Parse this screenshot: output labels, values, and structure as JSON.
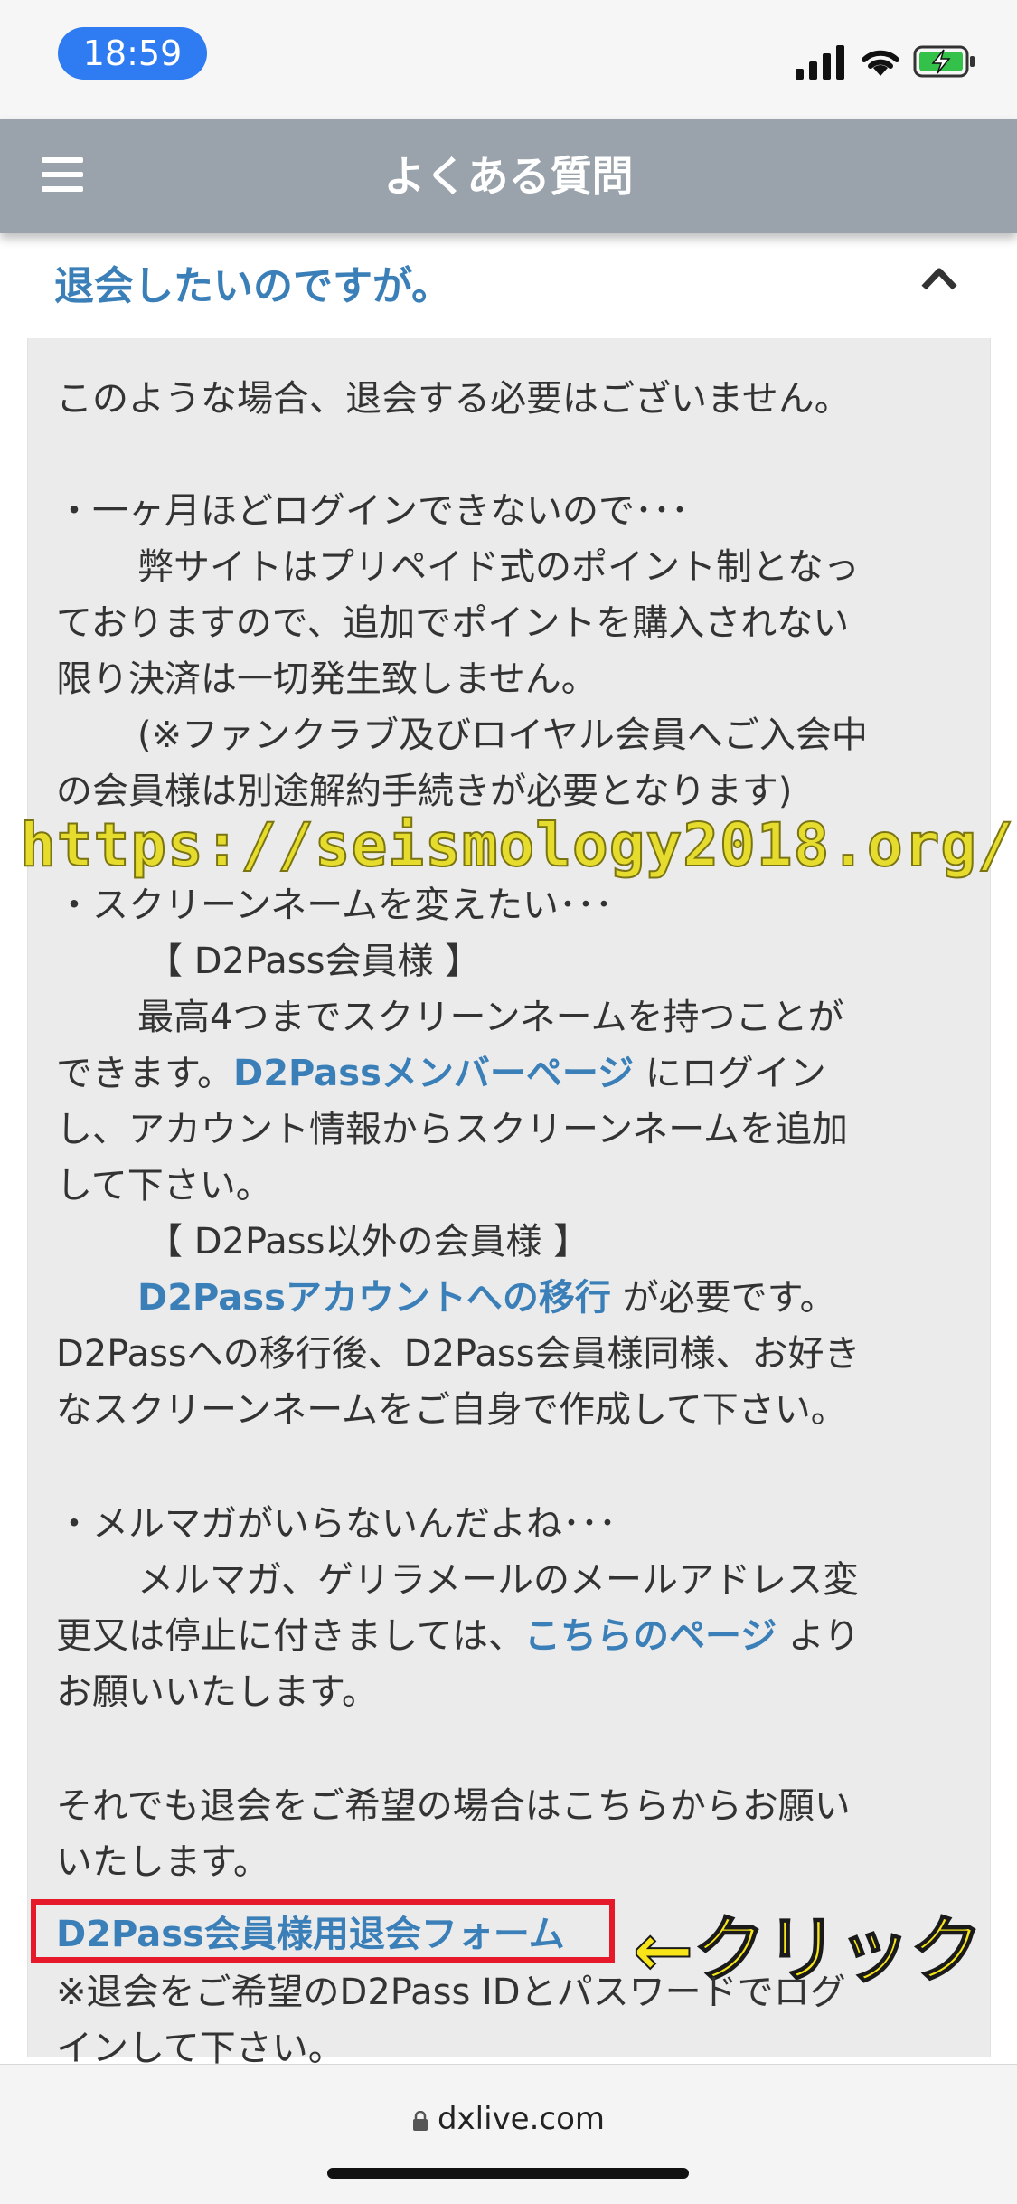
{
  "status_bar": {
    "time": "18:59"
  },
  "header": {
    "title": "よくある質問"
  },
  "faq": {
    "question": "退会したいのですが。",
    "answer": {
      "intro": "このような場合、退会する必要はございません。",
      "login_heading": "・一ヶ月ほどログインできないので･･･",
      "login_l1": "弊サイトはプリペイド式のポイント制となっ",
      "login_l2": "ておりますので、追加でポイントを購入されない",
      "login_l3": "限り決済は一切発生致しません。",
      "login_l4": "(※ファンクラブ及びロイヤル会員へご入会中",
      "login_l5": "の会員様は別途解約手続きが必要となります)",
      "screen_heading": "・スクリーンネームを変えたい･･･",
      "d2pass_member_heading": "【 D2Pass会員様 】",
      "d2pass_l1": "最高4つまでスクリーンネームを持つことが",
      "d2pass_l2_pre": "できます。",
      "d2pass_member_page_link": "D2Passメンバーページ",
      "d2pass_l2_post": " にログイン",
      "d2pass_l3": "し、アカウント情報からスクリーンネームを追加",
      "d2pass_l4": "して下さい。",
      "non_d2pass_heading": "【 D2Pass以外の会員様 】",
      "migration_link": "D2Passアカウントへの移行",
      "migration_post": " が必要です。",
      "non_d2pass_l2": "D2Passへの移行後、D2Pass会員様同様、お好き",
      "non_d2pass_l3": "なスクリーンネームをご自身で作成して下さい。",
      "mailmag_heading": "・メルマガがいらないんだよね･･･",
      "mailmag_l1": "メルマガ、ゲリラメールのメールアドレス変",
      "mailmag_l2_pre": "更又は停止に付きましては、",
      "this_page_link": "こちらのページ",
      "mailmag_l2_post": " より",
      "mailmag_l3": "お願いいたします。",
      "still_l1": "それでも退会をご希望の場合はこちらからお願い",
      "still_l2": "いたします。",
      "withdraw_form_link": "D2Pass会員様用退会フォーム",
      "note_l1": "※退会をご希望のD2Pass IDとパスワードでログ",
      "note_l2": "インして下さい。"
    }
  },
  "overlay": {
    "watermark": "https://seismology2018.org/",
    "click_annotation": "←クリック"
  },
  "bottom_bar": {
    "url": "dxlive.com"
  },
  "colors": {
    "link": "#3a7fb8",
    "header_bg": "#9aa3ab",
    "highlight_border": "#e5192a",
    "annotation": "#f7e51a"
  }
}
